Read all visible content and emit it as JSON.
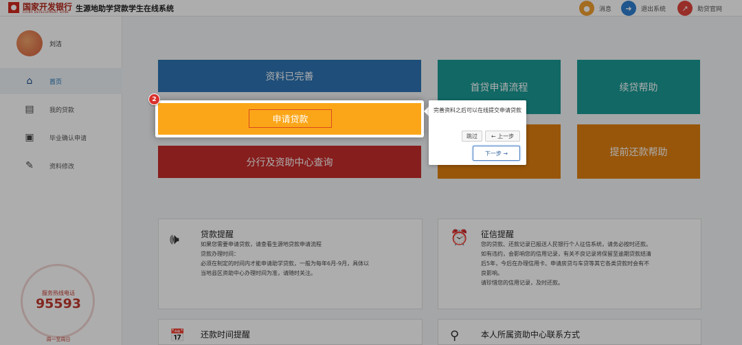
{
  "header": {
    "bank_name": "国家开发银行",
    "bank_name_en": "CHINA DEVELOPMENT BANK",
    "system_name": "生源地助学贷款学生在线系统",
    "actions": [
      {
        "label": "消息",
        "icon": "bell-icon",
        "color": "#f0a030"
      },
      {
        "label": "退出系统",
        "icon": "logout-icon",
        "color": "#2e7fd0"
      },
      {
        "label": "助贷官网",
        "icon": "external-link-icon",
        "color": "#e0443c"
      }
    ]
  },
  "sidebar": {
    "username": "刘洁",
    "items": [
      {
        "label": "首页",
        "icon": "home-icon"
      },
      {
        "label": "我的贷款",
        "icon": "document-icon"
      },
      {
        "label": "毕业确认申请",
        "icon": "inbox-icon"
      },
      {
        "label": "资料修改",
        "icon": "edit-icon"
      }
    ],
    "hotline_label": "服务热线电话",
    "hotline_number": "95593",
    "hotline_hours": "周一至周日"
  },
  "tiles": {
    "profile_complete": "资料已完善",
    "apply_loan": "申请贷款",
    "branch_query": "分行及资助中心查询",
    "first_loan_process": "首贷申请流程",
    "renewal_help": "续贷帮助",
    "early_repay_help": "提前还款帮助"
  },
  "cards": {
    "loan_reminder": {
      "title": "贷款提醒",
      "lines": [
        "如果您需要申请贷款，请查看生源地贷款申请流程",
        "贷款办理时间：",
        "必须在制定的时间内才能申请助学贷款，一般为每年6月-9月，具体以",
        "当地县区资助中心办理时间为准，请随时关注。"
      ]
    },
    "credit_reminder": {
      "title": "征信提醒",
      "lines": [
        "您的贷款、还款记录已报送人民银行个人征信系统，请务必按时还款。",
        "如有违约，会影响您的信用记录，有关不良记录将保留至逾期贷款结清",
        "后5年，今后在办理信用卡、申请房贷与车贷等其它各类贷款时会有不",
        "良影响。",
        "请珍惜您的信用记录，及时还款。"
      ]
    },
    "repay_time_reminder": {
      "title": "还款时间提醒"
    },
    "funding_center_contact": {
      "title": "本人所属资助中心联系方式"
    }
  },
  "tour": {
    "step": "2",
    "text": "完善资料之后可以在线提交申请贷款",
    "skip": "跳过",
    "prev": "← 上一步",
    "next": "下一步 →"
  }
}
